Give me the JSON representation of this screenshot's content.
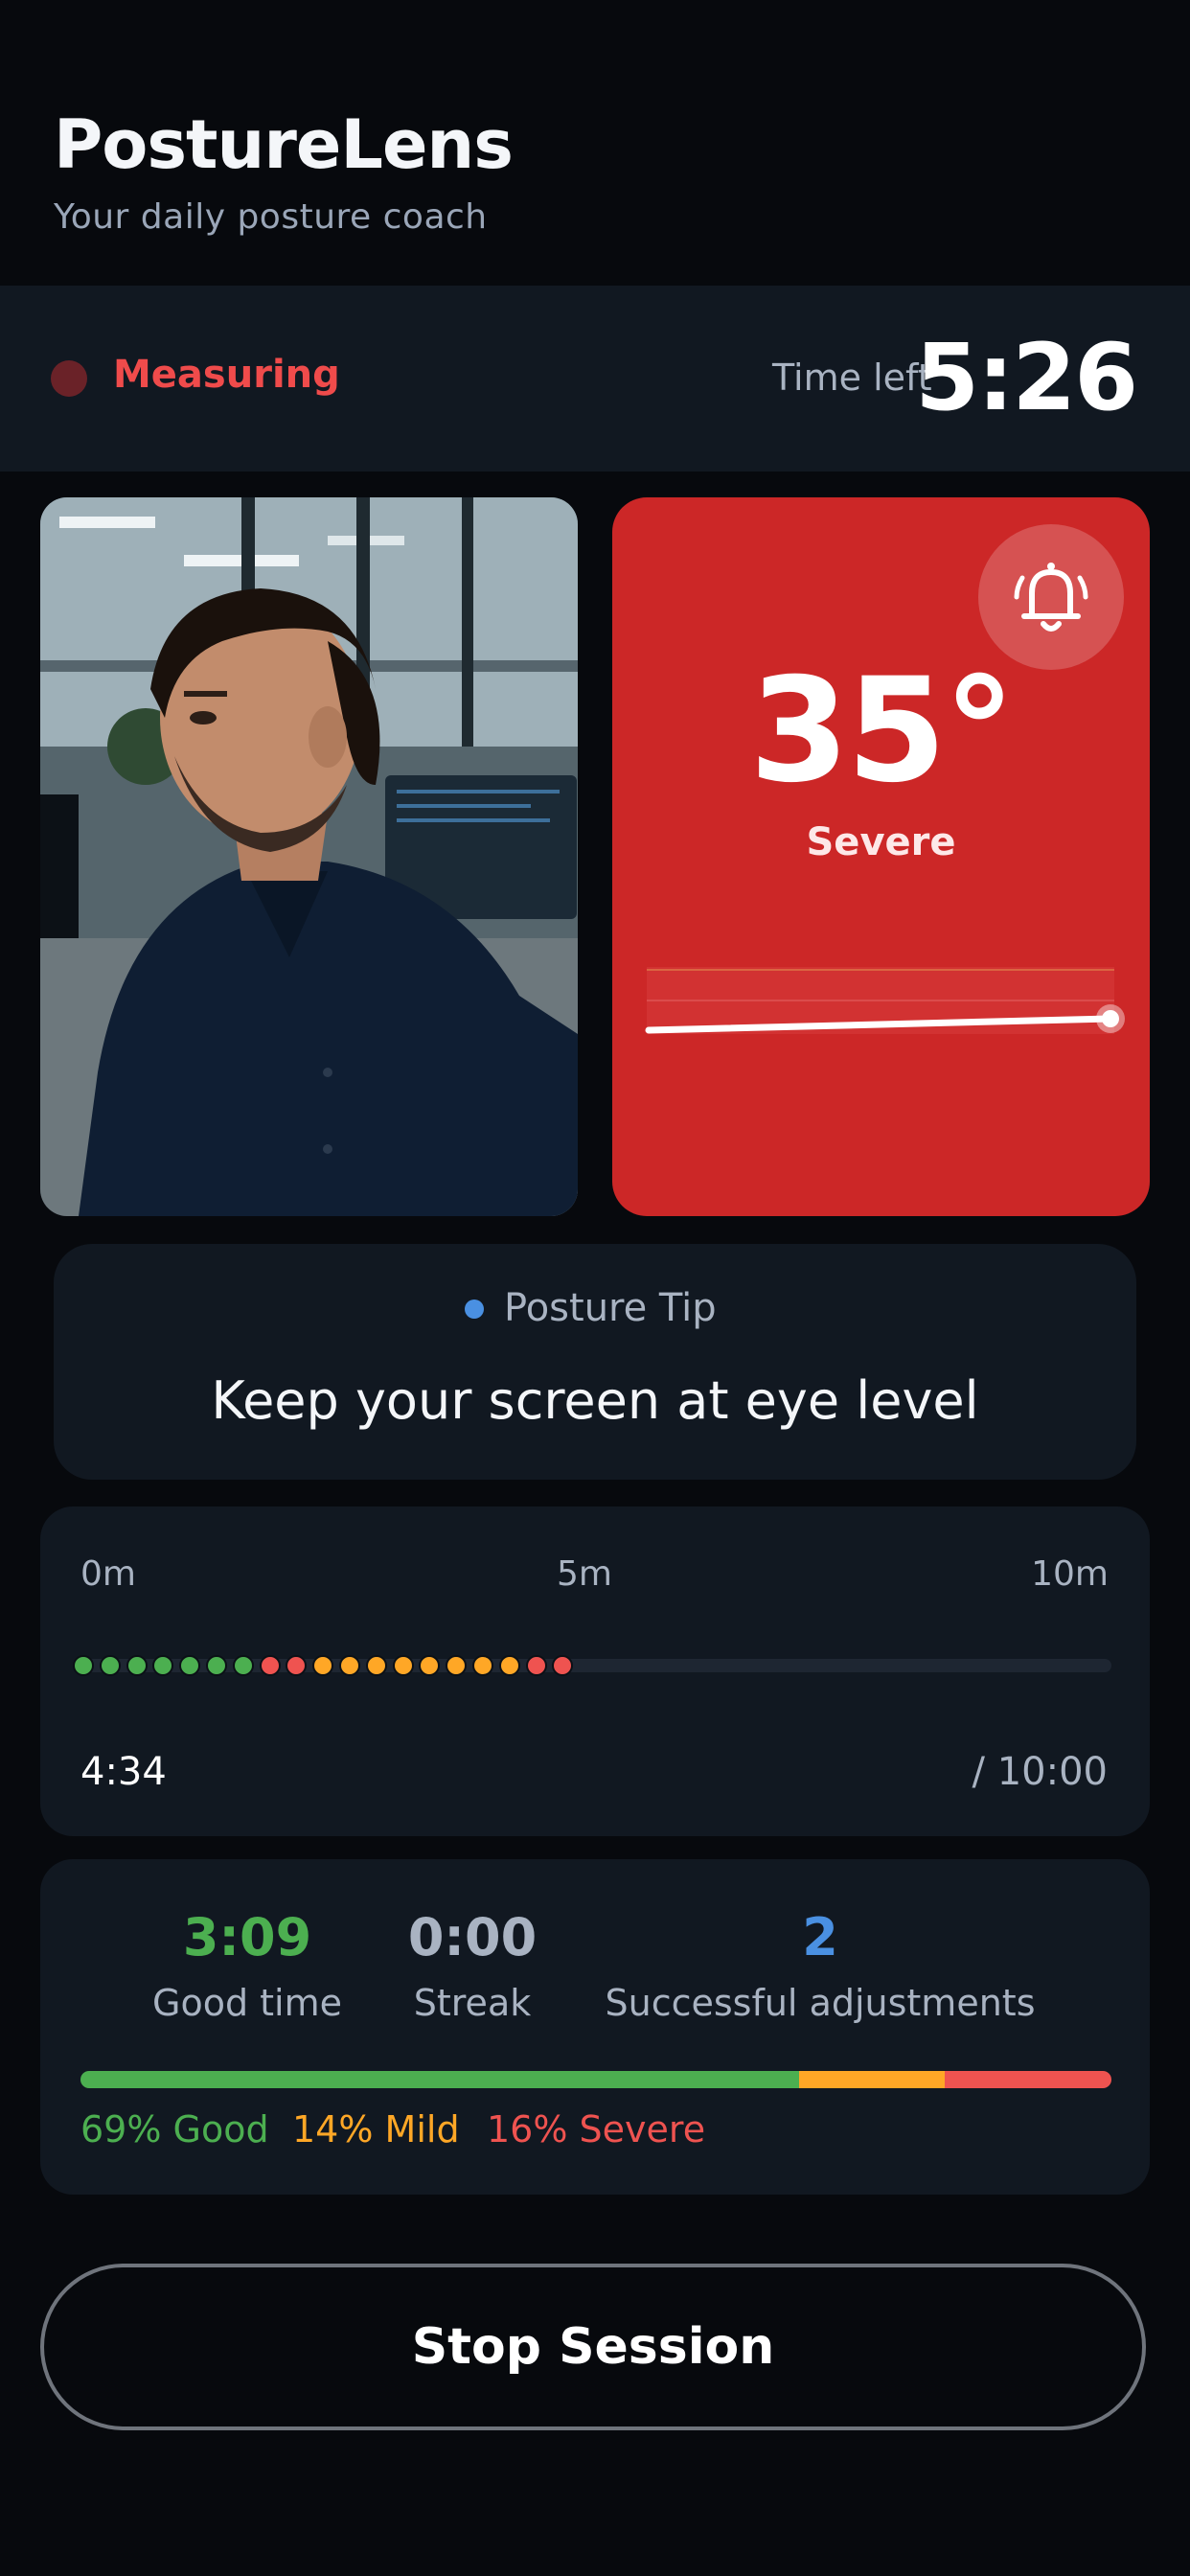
{
  "header": {
    "title": "PostureLens",
    "subtitle": "Your daily posture coach"
  },
  "status": {
    "label": "Measuring",
    "time_left_label": "Time left",
    "time_left_value": "5:26"
  },
  "angle": {
    "value": "35°",
    "severity": "Severe"
  },
  "tip": {
    "heading": "Posture Tip",
    "text": "Keep your screen at eye level"
  },
  "timeline": {
    "ticks": [
      "0m",
      "5m",
      "10m"
    ],
    "elapsed": "4:34",
    "total": "/ 10:00",
    "progress": 0.457,
    "samples": [
      "good",
      "good",
      "good",
      "good",
      "good",
      "good",
      "good",
      "severe",
      "severe",
      "mild",
      "mild",
      "mild",
      "mild",
      "mild",
      "mild",
      "mild",
      "mild",
      "severe",
      "severe"
    ]
  },
  "stats": {
    "good_time_value": "3:09",
    "good_time_label": "Good time",
    "streak_value": "0:00",
    "streak_label": "Streak",
    "adjustments_value": "2",
    "adjustments_label": "Successful adjustments",
    "distribution": [
      {
        "label": "69% Good",
        "percent": 69,
        "color": "#4caf50"
      },
      {
        "label": "14% Mild",
        "percent": 14,
        "color": "#ffa726"
      },
      {
        "label": "16% Severe",
        "percent": 16,
        "color": "#ef5350"
      }
    ]
  },
  "actions": {
    "stop_label": "Stop Session"
  },
  "colors": {
    "good": "#4caf50",
    "mild": "#ffa726",
    "severe": "#ef5350",
    "alert_card": "#cc2727",
    "accent_blue": "#4a90e2"
  },
  "icons": {
    "alert": "bell-ringing-icon",
    "status": "recording-dot-icon"
  }
}
